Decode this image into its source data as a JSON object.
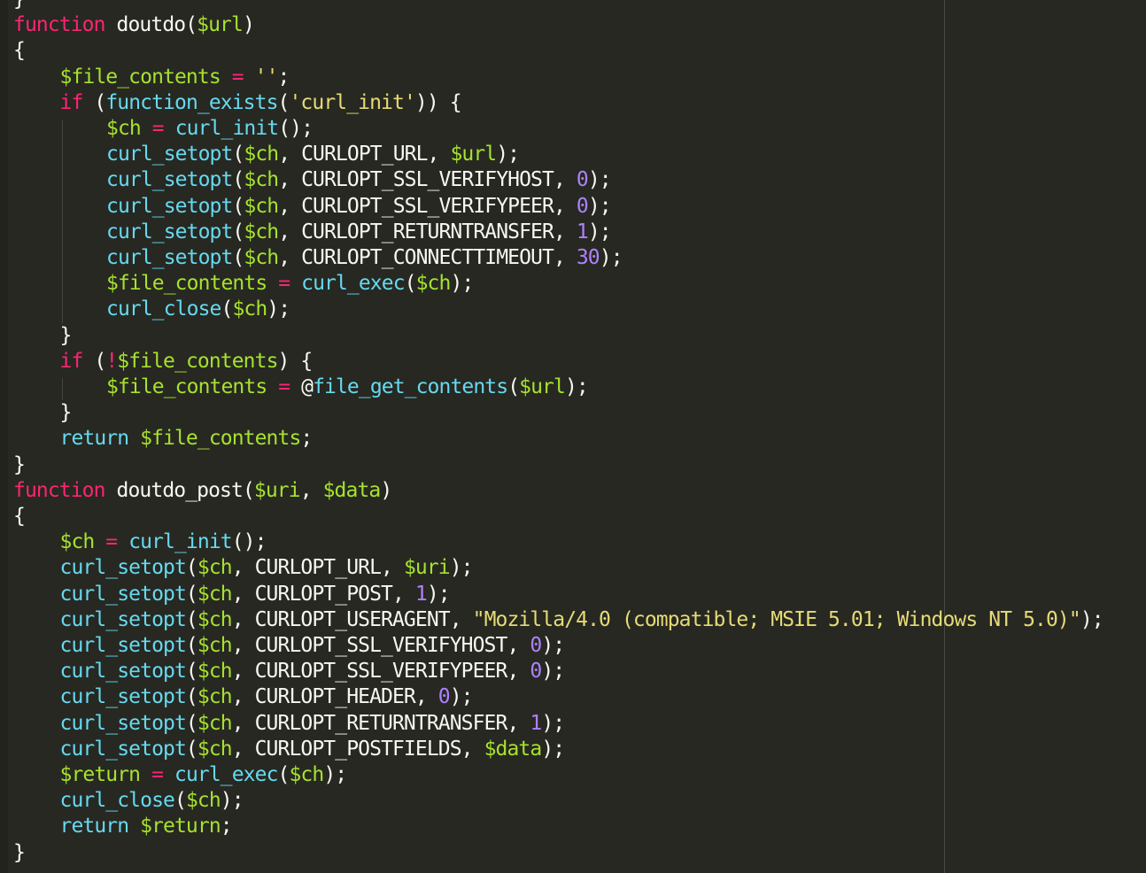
{
  "editor": {
    "theme_colors": {
      "background": "#272822",
      "keyword": "#f92672",
      "builtin": "#66d9ef",
      "variable": "#a6e22e",
      "string": "#e6db74",
      "number": "#ae81ff",
      "text": "#f8f8f2"
    },
    "lines": [
      {
        "indent": 0,
        "tokens": [
          {
            "t": "plain",
            "v": "}"
          }
        ]
      },
      {
        "indent": 0,
        "tokens": [
          {
            "t": "kw",
            "v": "function"
          },
          {
            "t": "plain",
            "v": " doutdo("
          },
          {
            "t": "var",
            "v": "$url"
          },
          {
            "t": "plain",
            "v": ")"
          }
        ]
      },
      {
        "indent": 0,
        "tokens": [
          {
            "t": "plain",
            "v": "{"
          }
        ]
      },
      {
        "indent": 1,
        "tokens": [
          {
            "t": "var",
            "v": "$file_contents"
          },
          {
            "t": "plain",
            "v": " "
          },
          {
            "t": "op",
            "v": "="
          },
          {
            "t": "plain",
            "v": " "
          },
          {
            "t": "str",
            "v": "''"
          },
          {
            "t": "plain",
            "v": ";"
          }
        ]
      },
      {
        "indent": 1,
        "tokens": [
          {
            "t": "kw",
            "v": "if"
          },
          {
            "t": "plain",
            "v": " ("
          },
          {
            "t": "fn",
            "v": "function_exists"
          },
          {
            "t": "plain",
            "v": "("
          },
          {
            "t": "str",
            "v": "'curl_init'"
          },
          {
            "t": "plain",
            "v": ")) {"
          }
        ]
      },
      {
        "indent": 2,
        "tokens": [
          {
            "t": "var",
            "v": "$ch"
          },
          {
            "t": "plain",
            "v": " "
          },
          {
            "t": "op",
            "v": "="
          },
          {
            "t": "plain",
            "v": " "
          },
          {
            "t": "fn",
            "v": "curl_init"
          },
          {
            "t": "plain",
            "v": "();"
          }
        ]
      },
      {
        "indent": 2,
        "tokens": [
          {
            "t": "fn",
            "v": "curl_setopt"
          },
          {
            "t": "plain",
            "v": "("
          },
          {
            "t": "var",
            "v": "$ch"
          },
          {
            "t": "plain",
            "v": ", CURLOPT_URL, "
          },
          {
            "t": "var",
            "v": "$url"
          },
          {
            "t": "plain",
            "v": ");"
          }
        ]
      },
      {
        "indent": 2,
        "tokens": [
          {
            "t": "fn",
            "v": "curl_setopt"
          },
          {
            "t": "plain",
            "v": "("
          },
          {
            "t": "var",
            "v": "$ch"
          },
          {
            "t": "plain",
            "v": ", CURLOPT_SSL_VERIFYHOST, "
          },
          {
            "t": "num",
            "v": "0"
          },
          {
            "t": "plain",
            "v": ");"
          }
        ]
      },
      {
        "indent": 2,
        "tokens": [
          {
            "t": "fn",
            "v": "curl_setopt"
          },
          {
            "t": "plain",
            "v": "("
          },
          {
            "t": "var",
            "v": "$ch"
          },
          {
            "t": "plain",
            "v": ", CURLOPT_SSL_VERIFYPEER, "
          },
          {
            "t": "num",
            "v": "0"
          },
          {
            "t": "plain",
            "v": ");"
          }
        ]
      },
      {
        "indent": 2,
        "tokens": [
          {
            "t": "fn",
            "v": "curl_setopt"
          },
          {
            "t": "plain",
            "v": "("
          },
          {
            "t": "var",
            "v": "$ch"
          },
          {
            "t": "plain",
            "v": ", CURLOPT_RETURNTRANSFER, "
          },
          {
            "t": "num",
            "v": "1"
          },
          {
            "t": "plain",
            "v": ");"
          }
        ]
      },
      {
        "indent": 2,
        "tokens": [
          {
            "t": "fn",
            "v": "curl_setopt"
          },
          {
            "t": "plain",
            "v": "("
          },
          {
            "t": "var",
            "v": "$ch"
          },
          {
            "t": "plain",
            "v": ", CURLOPT_CONNECTTIMEOUT, "
          },
          {
            "t": "num",
            "v": "30"
          },
          {
            "t": "plain",
            "v": ");"
          }
        ]
      },
      {
        "indent": 2,
        "tokens": [
          {
            "t": "var",
            "v": "$file_contents"
          },
          {
            "t": "plain",
            "v": " "
          },
          {
            "t": "op",
            "v": "="
          },
          {
            "t": "plain",
            "v": " "
          },
          {
            "t": "fn",
            "v": "curl_exec"
          },
          {
            "t": "plain",
            "v": "("
          },
          {
            "t": "var",
            "v": "$ch"
          },
          {
            "t": "plain",
            "v": ");"
          }
        ]
      },
      {
        "indent": 2,
        "tokens": [
          {
            "t": "fn",
            "v": "curl_close"
          },
          {
            "t": "plain",
            "v": "("
          },
          {
            "t": "var",
            "v": "$ch"
          },
          {
            "t": "plain",
            "v": ");"
          }
        ]
      },
      {
        "indent": 1,
        "tokens": [
          {
            "t": "plain",
            "v": "}"
          }
        ]
      },
      {
        "indent": 1,
        "tokens": [
          {
            "t": "kw",
            "v": "if"
          },
          {
            "t": "plain",
            "v": " ("
          },
          {
            "t": "op",
            "v": "!"
          },
          {
            "t": "var",
            "v": "$file_contents"
          },
          {
            "t": "plain",
            "v": ") {"
          }
        ]
      },
      {
        "indent": 2,
        "tokens": [
          {
            "t": "var",
            "v": "$file_contents"
          },
          {
            "t": "plain",
            "v": " "
          },
          {
            "t": "op",
            "v": "="
          },
          {
            "t": "plain",
            "v": " @"
          },
          {
            "t": "fn",
            "v": "file_get_contents"
          },
          {
            "t": "plain",
            "v": "("
          },
          {
            "t": "var",
            "v": "$url"
          },
          {
            "t": "plain",
            "v": ");"
          }
        ]
      },
      {
        "indent": 1,
        "tokens": [
          {
            "t": "plain",
            "v": "}"
          }
        ]
      },
      {
        "indent": 1,
        "tokens": [
          {
            "t": "ret",
            "v": "return"
          },
          {
            "t": "plain",
            "v": " "
          },
          {
            "t": "var",
            "v": "$file_contents"
          },
          {
            "t": "plain",
            "v": ";"
          }
        ]
      },
      {
        "indent": 0,
        "tokens": [
          {
            "t": "plain",
            "v": "}"
          }
        ]
      },
      {
        "indent": 0,
        "tokens": [
          {
            "t": "kw",
            "v": "function"
          },
          {
            "t": "plain",
            "v": " doutdo_post("
          },
          {
            "t": "var",
            "v": "$uri"
          },
          {
            "t": "plain",
            "v": ", "
          },
          {
            "t": "var",
            "v": "$data"
          },
          {
            "t": "plain",
            "v": ")"
          }
        ]
      },
      {
        "indent": 0,
        "tokens": [
          {
            "t": "plain",
            "v": "{"
          }
        ]
      },
      {
        "indent": 1,
        "tokens": [
          {
            "t": "var",
            "v": "$ch"
          },
          {
            "t": "plain",
            "v": " "
          },
          {
            "t": "op",
            "v": "="
          },
          {
            "t": "plain",
            "v": " "
          },
          {
            "t": "fn",
            "v": "curl_init"
          },
          {
            "t": "plain",
            "v": "();"
          }
        ]
      },
      {
        "indent": 1,
        "tokens": [
          {
            "t": "fn",
            "v": "curl_setopt"
          },
          {
            "t": "plain",
            "v": "("
          },
          {
            "t": "var",
            "v": "$ch"
          },
          {
            "t": "plain",
            "v": ", CURLOPT_URL, "
          },
          {
            "t": "var",
            "v": "$uri"
          },
          {
            "t": "plain",
            "v": ");"
          }
        ]
      },
      {
        "indent": 1,
        "tokens": [
          {
            "t": "fn",
            "v": "curl_setopt"
          },
          {
            "t": "plain",
            "v": "("
          },
          {
            "t": "var",
            "v": "$ch"
          },
          {
            "t": "plain",
            "v": ", CURLOPT_POST, "
          },
          {
            "t": "num",
            "v": "1"
          },
          {
            "t": "plain",
            "v": ");"
          }
        ]
      },
      {
        "indent": 1,
        "tokens": [
          {
            "t": "fn",
            "v": "curl_setopt"
          },
          {
            "t": "plain",
            "v": "("
          },
          {
            "t": "var",
            "v": "$ch"
          },
          {
            "t": "plain",
            "v": ", CURLOPT_USERAGENT, "
          },
          {
            "t": "str",
            "v": "\"Mozilla/4.0 (compatible; MSIE 5.01; Windows NT 5.0)\""
          },
          {
            "t": "plain",
            "v": ");"
          }
        ]
      },
      {
        "indent": 1,
        "tokens": [
          {
            "t": "fn",
            "v": "curl_setopt"
          },
          {
            "t": "plain",
            "v": "("
          },
          {
            "t": "var",
            "v": "$ch"
          },
          {
            "t": "plain",
            "v": ", CURLOPT_SSL_VERIFYHOST, "
          },
          {
            "t": "num",
            "v": "0"
          },
          {
            "t": "plain",
            "v": ");"
          }
        ]
      },
      {
        "indent": 1,
        "tokens": [
          {
            "t": "fn",
            "v": "curl_setopt"
          },
          {
            "t": "plain",
            "v": "("
          },
          {
            "t": "var",
            "v": "$ch"
          },
          {
            "t": "plain",
            "v": ", CURLOPT_SSL_VERIFYPEER, "
          },
          {
            "t": "num",
            "v": "0"
          },
          {
            "t": "plain",
            "v": ");"
          }
        ]
      },
      {
        "indent": 1,
        "tokens": [
          {
            "t": "fn",
            "v": "curl_setopt"
          },
          {
            "t": "plain",
            "v": "("
          },
          {
            "t": "var",
            "v": "$ch"
          },
          {
            "t": "plain",
            "v": ", CURLOPT_HEADER, "
          },
          {
            "t": "num",
            "v": "0"
          },
          {
            "t": "plain",
            "v": ");"
          }
        ]
      },
      {
        "indent": 1,
        "tokens": [
          {
            "t": "fn",
            "v": "curl_setopt"
          },
          {
            "t": "plain",
            "v": "("
          },
          {
            "t": "var",
            "v": "$ch"
          },
          {
            "t": "plain",
            "v": ", CURLOPT_RETURNTRANSFER, "
          },
          {
            "t": "num",
            "v": "1"
          },
          {
            "t": "plain",
            "v": ");"
          }
        ]
      },
      {
        "indent": 1,
        "tokens": [
          {
            "t": "fn",
            "v": "curl_setopt"
          },
          {
            "t": "plain",
            "v": "("
          },
          {
            "t": "var",
            "v": "$ch"
          },
          {
            "t": "plain",
            "v": ", CURLOPT_POSTFIELDS, "
          },
          {
            "t": "var",
            "v": "$data"
          },
          {
            "t": "plain",
            "v": ");"
          }
        ]
      },
      {
        "indent": 1,
        "tokens": [
          {
            "t": "var",
            "v": "$return"
          },
          {
            "t": "plain",
            "v": " "
          },
          {
            "t": "op",
            "v": "="
          },
          {
            "t": "plain",
            "v": " "
          },
          {
            "t": "fn",
            "v": "curl_exec"
          },
          {
            "t": "plain",
            "v": "("
          },
          {
            "t": "var",
            "v": "$ch"
          },
          {
            "t": "plain",
            "v": ");"
          }
        ]
      },
      {
        "indent": 1,
        "tokens": [
          {
            "t": "fn",
            "v": "curl_close"
          },
          {
            "t": "plain",
            "v": "("
          },
          {
            "t": "var",
            "v": "$ch"
          },
          {
            "t": "plain",
            "v": ");"
          }
        ]
      },
      {
        "indent": 1,
        "tokens": [
          {
            "t": "ret",
            "v": "return"
          },
          {
            "t": "plain",
            "v": " "
          },
          {
            "t": "var",
            "v": "$return"
          },
          {
            "t": "plain",
            "v": ";"
          }
        ]
      },
      {
        "indent": 0,
        "tokens": [
          {
            "t": "plain",
            "v": "}"
          }
        ]
      }
    ]
  }
}
